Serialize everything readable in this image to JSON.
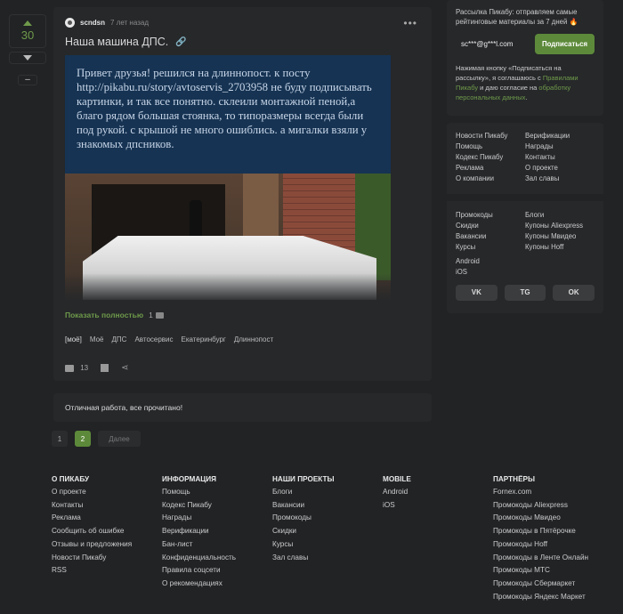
{
  "vote": {
    "count": "30",
    "minus": "–"
  },
  "story": {
    "author": "scndsn",
    "time": "7 лет назад",
    "title": "Наша машина ДПС.",
    "image_text": "Привет друзья! решился на длиннопост. к посту http://pikabu.ru/story/avtoservis_2703958 не буду подписывать картинки, и так все понятно. склеили монтажной пеной,а благо рядом большая стоянка, то типоразмеры всегда были под рукой. с крышой не много ошиблись. а мигалки взяли у знакомых дпсников.",
    "show_more": "Показать полностью",
    "image_count": "1",
    "tags": [
      "[моё]",
      "Моё",
      "ДПС",
      "Автосервис",
      "Екатеринбург",
      "Длиннопост"
    ],
    "comments": "13"
  },
  "notice": "Отличная работа, все прочитано!",
  "pager": {
    "p1": "1",
    "p2": "2",
    "next": "Далее"
  },
  "subscribe": {
    "text": "Рассылка Пикабу: отправляем самые рейтинговые материалы за 7 дней 🔥",
    "email": "sc***@g***l.com",
    "button": "Подписаться",
    "agree_pre": "Нажимая кнопку «Подписаться на рассылку», я соглашаюсь с ",
    "agree_link1": "Правилами Пикабу",
    "agree_mid": " и даю согласие на ",
    "agree_link2": "обработку персональных данных",
    "agree_post": "."
  },
  "side_links": {
    "left": [
      "Новости Пикабу",
      "Помощь",
      "Кодекс Пикабу",
      "Реклама",
      "О компании"
    ],
    "right": [
      "Верификации",
      "Награды",
      "Контакты",
      "О проекте",
      "Зал славы"
    ]
  },
  "side_promo": {
    "left": [
      "Промокоды",
      "Скидки",
      "Вакансии",
      "Курсы"
    ],
    "right": [
      "Блоги",
      "Купоны Aliexpress",
      "Купоны Мвидео",
      "Купоны Hoff"
    ]
  },
  "apps": [
    "Android",
    "iOS"
  ],
  "social": [
    "VK",
    "TG",
    "OK"
  ],
  "footer": {
    "about": {
      "title": "О ПИКАБУ",
      "items": [
        "О проекте",
        "Контакты",
        "Реклама",
        "Сообщить об ошибке",
        "Отзывы и предложения",
        "Новости Пикабу",
        "RSS"
      ]
    },
    "info": {
      "title": "ИНФОРМАЦИЯ",
      "items": [
        "Помощь",
        "Кодекс Пикабу",
        "Награды",
        "Верификации",
        "Бан-лист",
        "Конфиденциальность",
        "Правила соцсети",
        "О рекомендациях"
      ]
    },
    "projects": {
      "title": "НАШИ ПРОЕКТЫ",
      "items": [
        "Блоги",
        "Вакансии",
        "Промокоды",
        "Скидки",
        "Курсы",
        "Зал славы"
      ]
    },
    "mobile": {
      "title": "MOBILE",
      "items": [
        "Android",
        "iOS"
      ]
    },
    "partners": {
      "title": "ПАРТНЁРЫ",
      "items": [
        "Fornex.com",
        "Промокоды Aliexpress",
        "Промокоды Мвидео",
        "Промокоды в Пятёрочке",
        "Промокоды Hoff",
        "Промокоды в Ленте Онлайн",
        "Промокоды МТС",
        "Промокоды Сбермаркет",
        "Промокоды Яндекс Маркет"
      ]
    }
  }
}
